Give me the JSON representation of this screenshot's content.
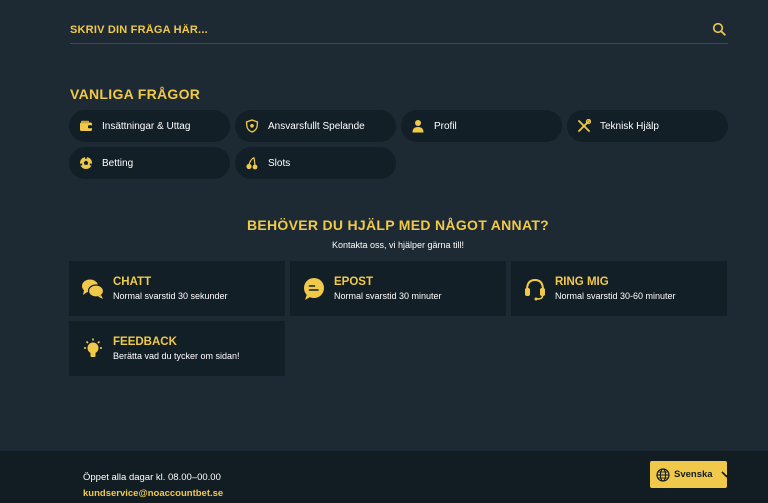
{
  "search": {
    "placeholder": "SKRIV DIN FRÅGA HÄR..."
  },
  "faq": {
    "title": "VANLIGA FRÅGOR",
    "categories": [
      {
        "label": "Insättningar & Uttag",
        "icon": "wallet-icon"
      },
      {
        "label": "Ansvarsfullt Spelande",
        "icon": "shield-icon"
      },
      {
        "label": "Profil",
        "icon": "user-icon"
      },
      {
        "label": "Teknisk Hjälp",
        "icon": "tools-icon"
      },
      {
        "label": "Betting",
        "icon": "soccer-ball-icon"
      },
      {
        "label": "Slots",
        "icon": "cherries-icon"
      }
    ]
  },
  "help": {
    "title": "BEHÖVER DU HJÄLP MED NÅGOT ANNAT?",
    "subtitle": "Kontakta oss, vi hjälper gärna till!",
    "contacts": [
      {
        "title": "CHATT",
        "desc": "Normal svarstid 30 sekunder",
        "icon": "chat-bubbles-icon"
      },
      {
        "title": "EPOST",
        "desc": "Normal svarstid 30 minuter",
        "icon": "email-bubble-icon"
      },
      {
        "title": "RING MIG",
        "desc": "Normal svarstid 30-60 minuter",
        "icon": "headset-icon"
      },
      {
        "title": "FEEDBACK",
        "desc": "Berätta vad du tycker om sidan!",
        "icon": "lightbulb-icon"
      }
    ]
  },
  "footer": {
    "hours": "Öppet alla dagar kl. 08.00–00.00",
    "email": "kundservice@noaccountbet.se",
    "language": "Svenska"
  },
  "colors": {
    "accent": "#f1c94a",
    "background": "#1d2a33",
    "card": "#131f27",
    "footer": "#111c23"
  }
}
